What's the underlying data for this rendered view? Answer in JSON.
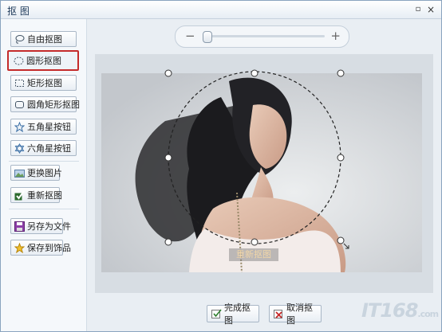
{
  "window": {
    "title": "抠 图",
    "min_glyph": "▫",
    "close_glyph": "×"
  },
  "tools": [
    {
      "label": "自由抠图",
      "icon": "lasso-icon"
    },
    {
      "label": "圆形抠图",
      "icon": "ellipse-select-icon",
      "active": true
    },
    {
      "label": "矩形抠图",
      "icon": "rect-select-icon"
    },
    {
      "label": "圆角矩形抠图",
      "icon": "rounded-rect-icon"
    },
    {
      "label": "五角星按钮",
      "icon": "star-outline-icon"
    },
    {
      "label": "六角星按钮",
      "icon": "hexagram-icon"
    },
    {
      "label": "更换图片",
      "icon": "image-icon"
    },
    {
      "label": "重新抠图",
      "icon": "check-brush-icon"
    },
    {
      "label": "另存为文件",
      "icon": "save-icon"
    },
    {
      "label": "保存到饰品",
      "icon": "star-save-icon"
    }
  ],
  "zoom": {
    "minus": "−",
    "plus": "+",
    "level": 0.0
  },
  "canvas": {
    "overlay_label": "重新抠图"
  },
  "footer": {
    "confirm": "完成抠图",
    "cancel": "取消抠图"
  },
  "watermark": {
    "text": "IT168",
    "suffix": ".com"
  }
}
